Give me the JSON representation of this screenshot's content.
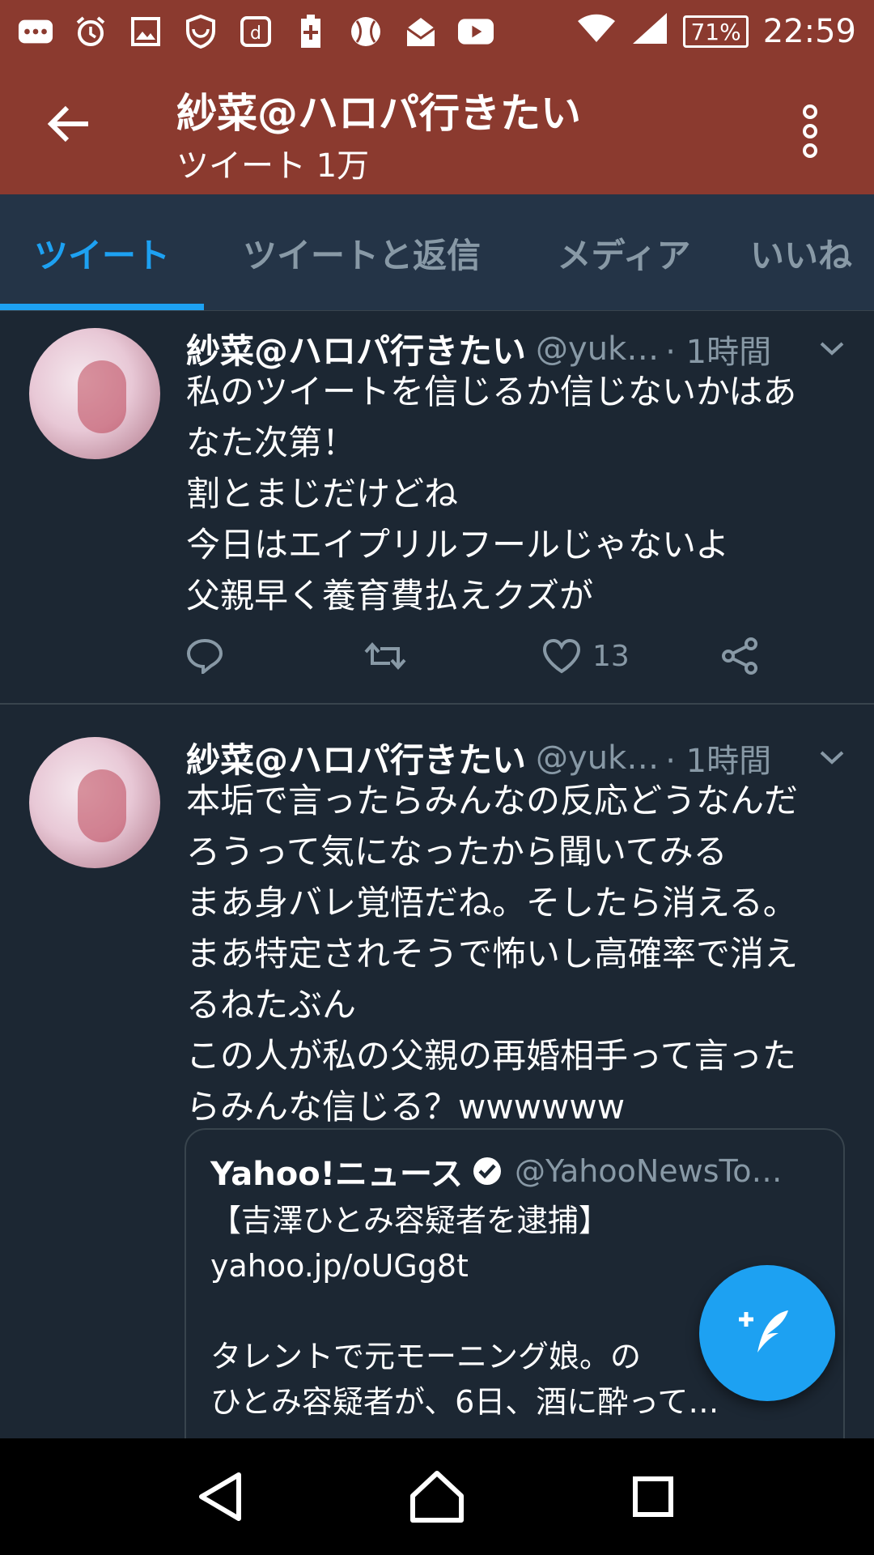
{
  "status_bar": {
    "icons": [
      "dots-notification-icon",
      "alarm-icon",
      "image-icon",
      "shield-icon",
      "d-app-icon",
      "battery-saver-icon",
      "baseball-icon",
      "mail-icon",
      "youtube-icon"
    ],
    "wifi_icon": "wifi-icon",
    "signal_icon": "signal-icon",
    "battery": "71%",
    "time": "22:59"
  },
  "app_bar": {
    "title": "紗菜@ハロパ行きたい",
    "subtitle": "ツイート 1万"
  },
  "tabs": [
    {
      "label": "ツイート",
      "active": true
    },
    {
      "label": "ツイートと返信",
      "active": false
    },
    {
      "label": "メディア",
      "active": false
    },
    {
      "label": "いいね",
      "active": false
    }
  ],
  "tweets": [
    {
      "name": "紗菜@ハロパ行きたい",
      "handle": "@yuk…",
      "time": "· 1時間",
      "body": "私のツイートを信じるか信じないかはあ\nなた次第！\n割とまじだけどね\n今日はエイプリルフールじゃないよ\n父親早く養育費払えクズが",
      "likes": "13"
    },
    {
      "name": "紗菜@ハロパ行きたい",
      "handle": "@yuk…",
      "time": "· 1時間",
      "body": "本垢で言ったらみんなの反応どうなんだ\nろうって気になったから聞いてみる\nまあ身バレ覚悟だね。そしたら消える。\nまあ特定されそうで怖いし高確率で消え\nるねたぶん\nこの人が私の父親の再婚相手って言った\nらみんな信じる？wwwwww",
      "quote": {
        "name": "Yahoo!ニュース",
        "handle": "@YahooNewsTo…",
        "body": "【吉澤ひとみ容疑者を逮捕】\nyahoo.jp/oUGg8t\n\nタレントで元モーニング娘。の\nひとみ容疑者が、6日、酒に酔って…"
      }
    }
  ],
  "colors": {
    "app_bar": "#8b3a2f",
    "background": "#1c2733",
    "tab_bar": "#243447",
    "accent": "#1da1f2",
    "muted_text": "#8899a6",
    "divider": "#38444d"
  }
}
